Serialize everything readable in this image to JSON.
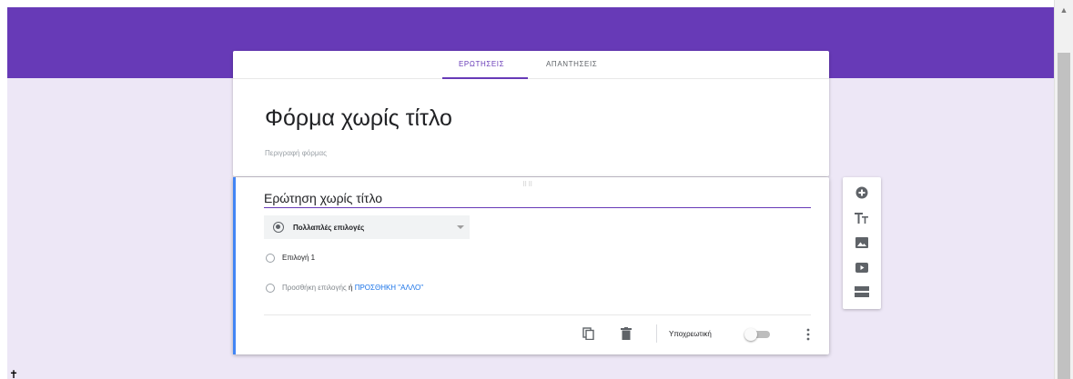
{
  "tabs": [
    {
      "label": "ΕΡΩΤΗΣΕΙΣ",
      "active": true
    },
    {
      "label": "ΑΠΑΝΤΗΣΕΙΣ",
      "active": false
    }
  ],
  "form": {
    "title": "Φόρμα χωρίς τίτλο",
    "description_placeholder": "Περιγραφή φόρμας"
  },
  "question": {
    "title": "Ερώτηση χωρίς τίτλο",
    "type_label": "Πολλαπλές επιλογές",
    "options": [
      {
        "label": "Επιλογή 1"
      }
    ],
    "add_option": {
      "text": "Προσθήκη επιλογής",
      "or": " ή ",
      "link": "ΠΡΟΣΘΗΚΗ \"ΑΛΛΟ\""
    },
    "required_label": "Υποχρεωτική",
    "required": false
  },
  "toolbar": {
    "items": [
      "add-question-icon",
      "add-title-icon",
      "add-image-icon",
      "add-video-icon",
      "add-section-icon"
    ]
  },
  "colors": {
    "brand": "#673ab7",
    "background": "#ede7f6",
    "accent": "#4285f4",
    "link": "#1a73e8"
  }
}
